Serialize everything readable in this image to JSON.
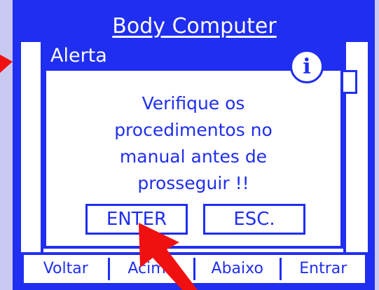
{
  "app": {
    "title": "Body Computer"
  },
  "dialog": {
    "title": "Alerta",
    "icon": "info-icon",
    "message_lines": [
      "Verifique os",
      "procedimentos no",
      "manual antes de",
      "prosseguir !!"
    ],
    "buttons": {
      "enter_label": "ENTER",
      "esc_label": "ESC."
    }
  },
  "bottom_bar": {
    "items": [
      {
        "label": "Voltar"
      },
      {
        "label": "Acima"
      },
      {
        "label": "Abaixo"
      },
      {
        "label": "Entrar"
      }
    ]
  },
  "colors": {
    "accent": "#1f2ef0",
    "background": "#c9c8f0",
    "annotation_arrow": "#f01010"
  }
}
